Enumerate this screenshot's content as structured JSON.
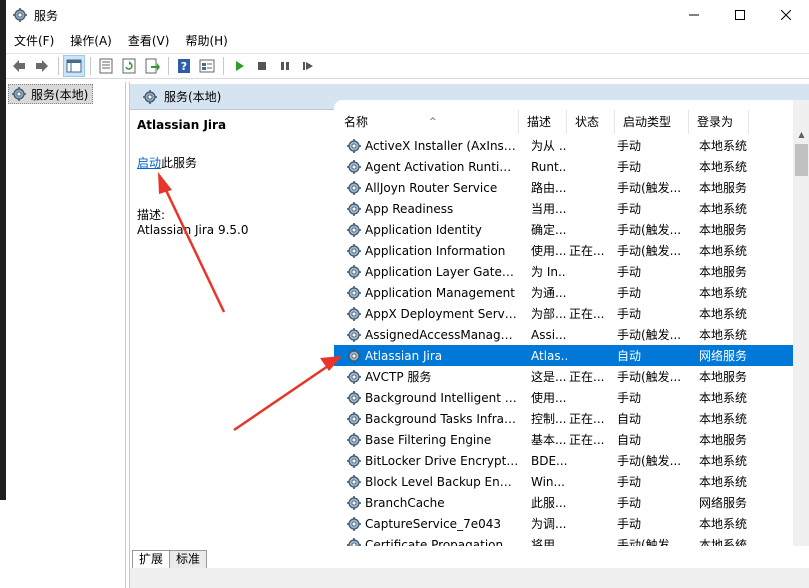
{
  "window": {
    "title": "服务"
  },
  "menu": [
    "文件(F)",
    "操作(A)",
    "查看(V)",
    "帮助(H)"
  ],
  "tree": {
    "selected": "服务(本地)"
  },
  "main": {
    "header": "服务(本地)",
    "description": {
      "title": "Atlassian Jira",
      "start_link": "启动",
      "start_suffix": "此服务",
      "desc_label": "描述:",
      "desc_text": "Atlassian Jira 9.5.0"
    },
    "columns": [
      "名称",
      "描述",
      "状态",
      "启动类型",
      "登录为"
    ],
    "rows": [
      {
        "name": "ActiveX Installer (AxInstSV)",
        "desc": "为从 ...",
        "status": "",
        "start": "手动",
        "logon": "本地系统"
      },
      {
        "name": "Agent Activation Runtime...",
        "desc": "Runt...",
        "status": "",
        "start": "手动",
        "logon": "本地系统"
      },
      {
        "name": "AllJoyn Router Service",
        "desc": "路由...",
        "status": "",
        "start": "手动(触发...",
        "logon": "本地服务"
      },
      {
        "name": "App Readiness",
        "desc": "当用...",
        "status": "",
        "start": "手动",
        "logon": "本地系统"
      },
      {
        "name": "Application Identity",
        "desc": "确定...",
        "status": "",
        "start": "手动(触发...",
        "logon": "本地服务"
      },
      {
        "name": "Application Information",
        "desc": "使用...",
        "status": "正在...",
        "start": "手动(触发...",
        "logon": "本地系统"
      },
      {
        "name": "Application Layer Gatewa...",
        "desc": "为 In...",
        "status": "",
        "start": "手动",
        "logon": "本地服务"
      },
      {
        "name": "Application Management",
        "desc": "为通...",
        "status": "",
        "start": "手动",
        "logon": "本地系统"
      },
      {
        "name": "AppX Deployment Servic...",
        "desc": "为部...",
        "status": "正在...",
        "start": "手动",
        "logon": "本地系统"
      },
      {
        "name": "AssignedAccessManager...",
        "desc": "Assi...",
        "status": "",
        "start": "手动(触发...",
        "logon": "本地系统"
      },
      {
        "name": "Atlassian Jira",
        "desc": "Atlas...",
        "status": "",
        "start": "自动",
        "logon": "网络服务",
        "selected": true
      },
      {
        "name": "AVCTP 服务",
        "desc": "这是...",
        "status": "正在...",
        "start": "手动(触发...",
        "logon": "本地服务"
      },
      {
        "name": "Background Intelligent T...",
        "desc": "使用...",
        "status": "",
        "start": "手动",
        "logon": "本地系统"
      },
      {
        "name": "Background Tasks Infras...",
        "desc": "控制...",
        "status": "正在...",
        "start": "自动",
        "logon": "本地系统"
      },
      {
        "name": "Base Filtering Engine",
        "desc": "基本...",
        "status": "正在...",
        "start": "自动",
        "logon": "本地服务"
      },
      {
        "name": "BitLocker Drive Encryptio...",
        "desc": "BDE...",
        "status": "",
        "start": "手动(触发...",
        "logon": "本地系统"
      },
      {
        "name": "Block Level Backup Engi...",
        "desc": "Win...",
        "status": "",
        "start": "手动",
        "logon": "本地系统"
      },
      {
        "name": "BranchCache",
        "desc": "此服...",
        "status": "",
        "start": "手动",
        "logon": "网络服务"
      },
      {
        "name": "CaptureService_7e043",
        "desc": "为调...",
        "status": "",
        "start": "手动",
        "logon": "本地系统"
      },
      {
        "name": "Certificate Propagation",
        "desc": "将用...",
        "status": "",
        "start": "手动(触发...",
        "logon": "本地系统"
      }
    ]
  },
  "tabs": [
    "扩展",
    "标准"
  ],
  "colors": {
    "selected_row": "#0078d7",
    "header_bg": "#d6e3f0",
    "link": "#0066cc",
    "annotation_arrow": "#e8352a"
  }
}
